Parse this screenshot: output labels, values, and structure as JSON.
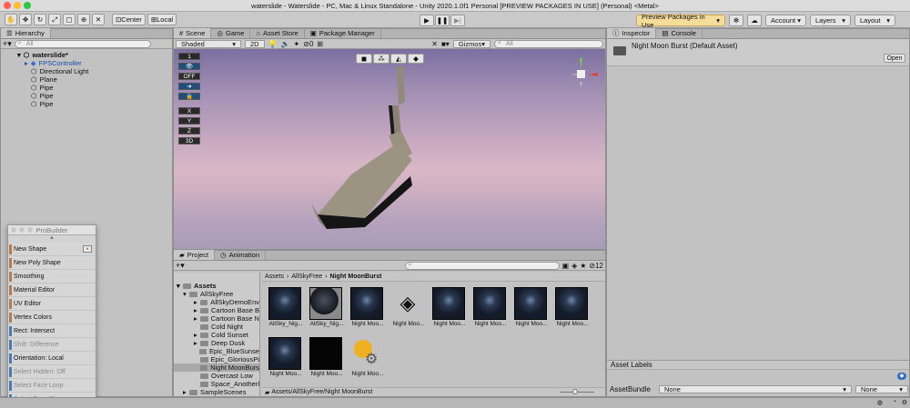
{
  "window": {
    "title": "waterslide - Waterslide - PC, Mac & Linux Standalone - Unity 2020.1.0f1 Personal [PREVIEW PACKAGES IN USE] (Personal) <Metal>"
  },
  "toolbar": {
    "center_label": "Center",
    "local_label": "Local",
    "preview_packages": "Preview Packages in Use",
    "account": "Account",
    "layers": "Layers",
    "layout": "Layout"
  },
  "hierarchy": {
    "tab": "Hierarchy",
    "search_placeholder": "All",
    "scene": "waterslide*",
    "items": [
      "FPSController",
      "Directional Light",
      "Plane",
      "Pipe",
      "Pipe",
      "Pipe"
    ]
  },
  "scene": {
    "tabs": [
      "Scene",
      "Game",
      "Asset Store",
      "Package Manager"
    ],
    "shading": "Shaded",
    "mode2d": "2D",
    "gizmos": "Gizmos",
    "search_placeholder": "All",
    "hidden_count": "0",
    "badges": [
      "1",
      "OFF",
      "X",
      "Y",
      "Z",
      "3D"
    ]
  },
  "probuilder": {
    "title": "ProBuilder",
    "items": [
      {
        "label": "New Shape",
        "color": "#b77a4a",
        "enabled": true
      },
      {
        "label": "New Poly Shape",
        "color": "#b77a4a",
        "enabled": true
      },
      {
        "label": "Smoothing",
        "color": "#b77a4a",
        "enabled": true
      },
      {
        "label": "Material Editor",
        "color": "#b77a4a",
        "enabled": true
      },
      {
        "label": "UV Editor",
        "color": "#b77a4a",
        "enabled": true
      },
      {
        "label": "Vertex Colors",
        "color": "#b77a4a",
        "enabled": true
      },
      {
        "label": "Rect: Intersect",
        "color": "#4a7ab7",
        "enabled": true
      },
      {
        "label": "Shift: Difference",
        "color": "#4a7ab7",
        "enabled": false
      },
      {
        "label": "Orientation: Local",
        "color": "#4a7ab7",
        "enabled": true
      },
      {
        "label": "Select Hidden: Off",
        "color": "#4a7ab7",
        "enabled": false
      },
      {
        "label": "Select Face Loop",
        "color": "#4a7ab7",
        "enabled": false
      },
      {
        "label": "Select Face Ring",
        "color": "#4a7ab7",
        "enabled": false
      }
    ]
  },
  "project": {
    "tabs": [
      "Project",
      "Animation"
    ],
    "count": "12",
    "tree": [
      "Assets",
      "AllSkyFree",
      "AllSkyDemoEnv",
      "Cartoon Base B",
      "Cartoon Base N",
      "Cold Night",
      "Cold Sunset",
      "Deep Dusk",
      "Epic_BlueSunse",
      "Epic_GloriousPi",
      "Night MoonBurs",
      "Overcast Low",
      "Space_Anotherl",
      "SampleScenes"
    ],
    "breadcrumb": [
      "Assets",
      "AllSkyFree",
      "Night MoonBurst"
    ],
    "assets": [
      "AllSky_Nig...",
      "AllSky_Nig...",
      "Night Moo...",
      "Night Moo...",
      "Night Moo...",
      "Night Moo...",
      "Night Moo...",
      "Night Moo...",
      "Night Moo...",
      "Night Moo...",
      "Night Moo..."
    ],
    "path": "Assets/AllSkyFree/Night MoonBurst"
  },
  "inspector": {
    "tabs": [
      "Inspector",
      "Console"
    ],
    "asset_title": "Night Moon Burst (Default Asset)",
    "open": "Open",
    "labels_title": "Asset Labels",
    "bundle_label": "AssetBundle",
    "bundle_value": "None",
    "variant_value": "None"
  }
}
